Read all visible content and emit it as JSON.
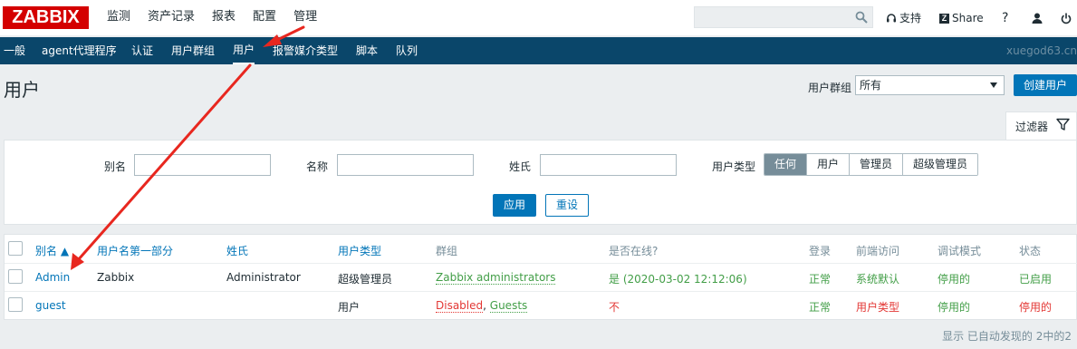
{
  "logo": "ZABBIX",
  "main_nav": [
    "监测",
    "资产记录",
    "报表",
    "配置",
    "管理"
  ],
  "top_right": {
    "support": "支持",
    "share": "Share",
    "help": "?"
  },
  "sub_nav": [
    "一般",
    "agent代理程序",
    "认证",
    "用户群组",
    "用户",
    "报警媒介类型",
    "脚本",
    "队列"
  ],
  "sub_nav_active": "用户",
  "host": "xuegod63.cn",
  "page_title": "用户",
  "group_filter": {
    "label": "用户群组",
    "value": "所有"
  },
  "create_button": "创建用户",
  "filter": {
    "tab_label": "过滤器",
    "alias_label": "别名",
    "name_label": "名称",
    "surname_label": "姓氏",
    "user_type_label": "用户类型",
    "user_type_options": [
      "任何",
      "用户",
      "管理员",
      "超级管理员"
    ],
    "user_type_selected": "任何",
    "apply": "应用",
    "reset": "重设"
  },
  "table": {
    "headers": [
      "别名 ▲",
      "用户名第一部分",
      "姓氏",
      "用户类型",
      "群组",
      "是否在线?",
      "登录",
      "前端访问",
      "调试模式",
      "状态"
    ],
    "rows": [
      {
        "alias": "Admin",
        "name": "Zabbix",
        "surname": "Administrator",
        "type": "超级管理员",
        "groups": [
          "Zabbix administrators"
        ],
        "online": "是 (2020-03-02 12:12:06)",
        "login": "正常",
        "frontend": "系统默认",
        "debug": "停用的",
        "status": "已启用"
      },
      {
        "alias": "guest",
        "name": "",
        "surname": "",
        "type": "用户",
        "groups_disabled": "Disabled",
        "groups_sep": ", ",
        "groups_guests": "Guests",
        "online": "不",
        "login": "正常",
        "frontend": "用户类型",
        "debug": "停用的",
        "status": "停用的"
      }
    ]
  },
  "footer": "显示 已自动发现的 2中的2",
  "colors": {
    "brand": "#d40000",
    "subnav": "#0a466a",
    "link": "#0275b8",
    "green": "#429e47",
    "red": "#e33734",
    "annotation_arrow": "#e8271f"
  }
}
